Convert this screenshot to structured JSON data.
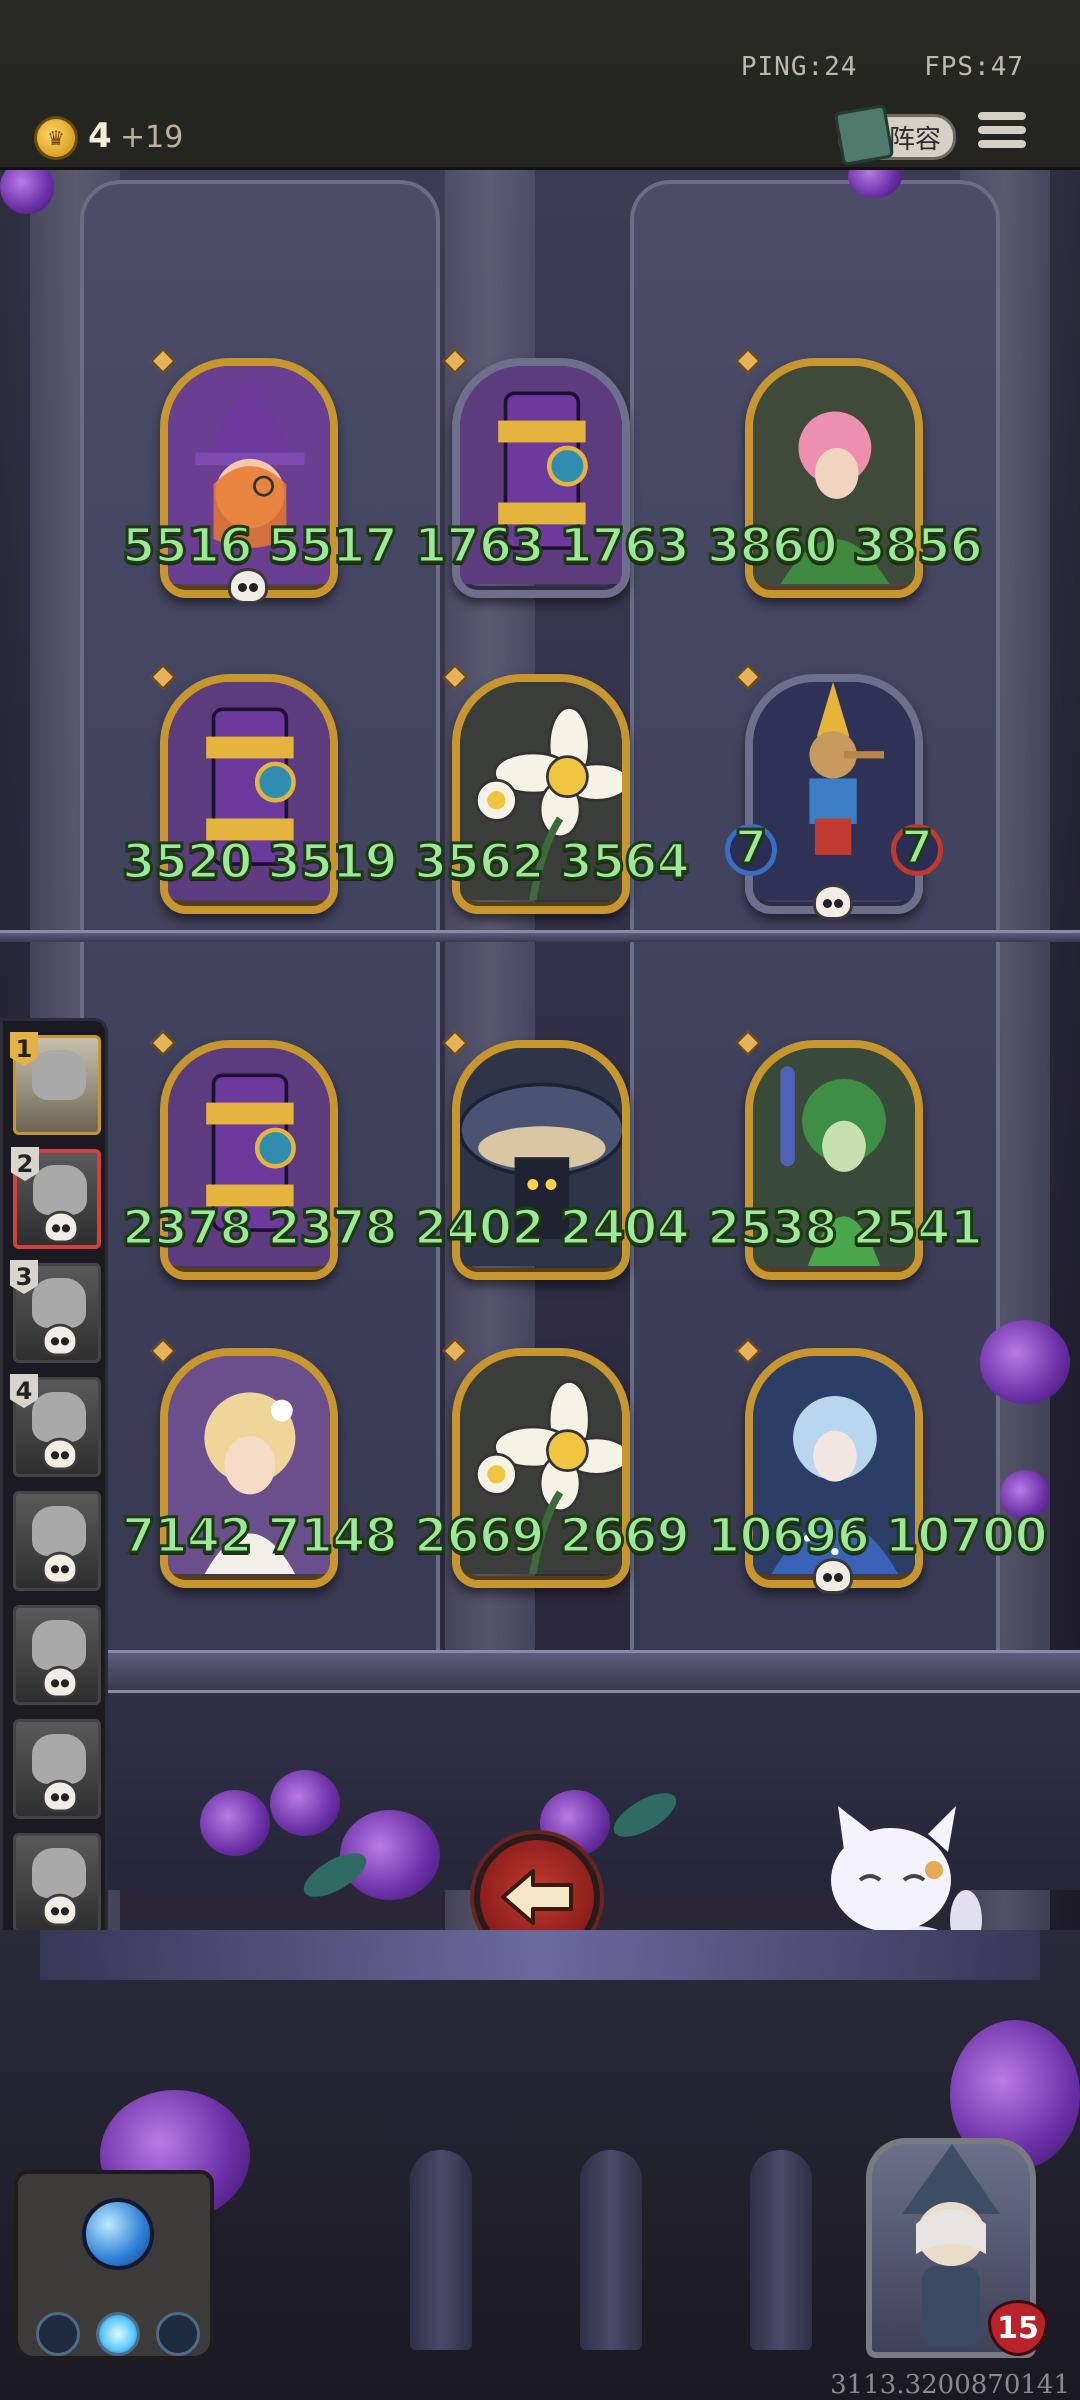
{
  "hud": {
    "ping": "PING:24",
    "fps": "FPS:47",
    "coins": "4",
    "coin_bonus": "+19",
    "lineup_label": "阵容"
  },
  "board": {
    "cards": [
      {
        "left": "5516",
        "right": "5517",
        "frame": "gold",
        "hero": "witch"
      },
      {
        "left": "1763",
        "right": "1763",
        "frame": "silver",
        "hero": "drum"
      },
      {
        "left": "3860",
        "right": "3856",
        "frame": "gold",
        "hero": "plant-girl"
      },
      {
        "left": "3520",
        "right": "3519",
        "frame": "gold",
        "hero": "drum"
      },
      {
        "left": "3562",
        "right": "3564",
        "frame": "gold",
        "hero": "flowers"
      },
      {
        "left": "7",
        "right": "7",
        "frame": "silver",
        "hero": "pinocchio"
      },
      {
        "left": "2378",
        "right": "2378",
        "frame": "gold",
        "hero": "drum"
      },
      {
        "left": "2402",
        "right": "2404",
        "frame": "gold",
        "hero": "mushroom"
      },
      {
        "left": "2538",
        "right": "2541",
        "frame": "gold",
        "hero": "dryad"
      },
      {
        "left": "7142",
        "right": "7148",
        "frame": "gold",
        "hero": "elf"
      },
      {
        "left": "2669",
        "right": "2669",
        "frame": "gold",
        "hero": "flowers"
      },
      {
        "left": "10696",
        "right": "10700",
        "frame": "gold",
        "hero": "ice-princess"
      }
    ]
  },
  "bench": {
    "slots": [
      {
        "num": "1",
        "state": "active"
      },
      {
        "num": "2",
        "state": "selected"
      },
      {
        "num": "3",
        "state": "dead"
      },
      {
        "num": "4",
        "state": "dead"
      },
      {
        "num": "",
        "state": "dead"
      },
      {
        "num": "",
        "state": "dead"
      },
      {
        "num": "",
        "state": "dead"
      },
      {
        "num": "",
        "state": "dead"
      }
    ]
  },
  "return_label": "返回",
  "player": {
    "hp": "15"
  },
  "seed": "3113.3200870141",
  "colors": {
    "stat_green": "#9de89b",
    "gold_frame": "#c8962f",
    "return_red": "#c23a31"
  }
}
